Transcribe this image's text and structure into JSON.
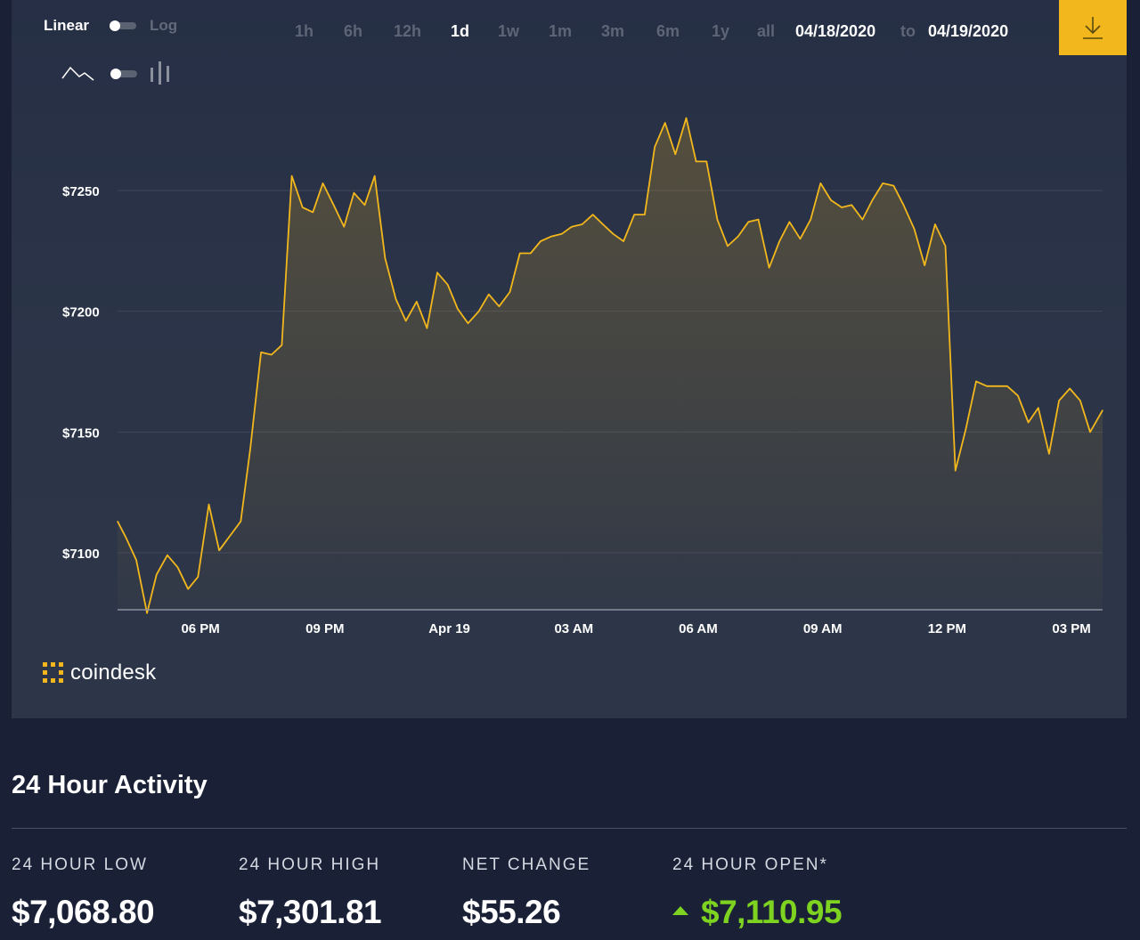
{
  "toolbar": {
    "scale_linear": "Linear",
    "scale_log": "Log",
    "ranges": [
      "1h",
      "6h",
      "12h",
      "1d",
      "1w",
      "1m",
      "3m",
      "6m",
      "1y",
      "all"
    ],
    "active_range": "1d",
    "date_from": "04/18/2020",
    "date_to_label": "to",
    "date_to": "04/19/2020",
    "download_icon": "download-icon",
    "line_icon": "line-chart-icon",
    "bar_icon": "candlestick-icon"
  },
  "brand": {
    "name": "coindesk",
    "icon": "coindesk-logo-icon",
    "color": "#f2b71c"
  },
  "colors": {
    "line": "#f2b71c",
    "accent": "#f2b71c",
    "positive": "#7ed321",
    "background": "#1a2137",
    "panel": "#2b3447"
  },
  "chart_data": {
    "type": "area",
    "x_tick_labels": [
      "06 PM",
      "09 PM",
      "Apr 19",
      "03 AM",
      "06 AM",
      "09 AM",
      "12 PM",
      "03 PM"
    ],
    "y_tick_labels": [
      "$7250",
      "$7200",
      "$7150",
      "$7100"
    ],
    "y_ticks": [
      7250,
      7200,
      7150,
      7100
    ],
    "ylim": [
      7076,
      7280
    ],
    "x_hours": [
      0,
      23.75
    ],
    "grid": true,
    "series": [
      {
        "values": [
          [
            0.0,
            7113
          ],
          [
            0.21,
            7106
          ],
          [
            0.45,
            7097
          ],
          [
            0.71,
            7075
          ],
          [
            0.94,
            7091
          ],
          [
            1.2,
            7099
          ],
          [
            1.45,
            7094
          ],
          [
            1.7,
            7085
          ],
          [
            1.94,
            7090
          ],
          [
            2.2,
            7120
          ],
          [
            2.45,
            7101
          ],
          [
            2.71,
            7107
          ],
          [
            2.97,
            7113
          ],
          [
            3.2,
            7143
          ],
          [
            3.46,
            7183
          ],
          [
            3.71,
            7182
          ],
          [
            3.96,
            7186
          ],
          [
            4.2,
            7256
          ],
          [
            4.46,
            7243
          ],
          [
            4.71,
            7241
          ],
          [
            4.95,
            7253
          ],
          [
            5.21,
            7244
          ],
          [
            5.46,
            7235
          ],
          [
            5.7,
            7249
          ],
          [
            5.96,
            7244
          ],
          [
            6.2,
            7256
          ],
          [
            6.45,
            7222
          ],
          [
            6.71,
            7205
          ],
          [
            6.95,
            7196
          ],
          [
            7.21,
            7204
          ],
          [
            7.46,
            7193
          ],
          [
            7.71,
            7216
          ],
          [
            7.96,
            7211
          ],
          [
            8.2,
            7201
          ],
          [
            8.45,
            7195
          ],
          [
            8.71,
            7200
          ],
          [
            8.95,
            7207
          ],
          [
            9.2,
            7202
          ],
          [
            9.46,
            7208
          ],
          [
            9.7,
            7224
          ],
          [
            9.96,
            7224
          ],
          [
            10.2,
            7229
          ],
          [
            10.46,
            7231
          ],
          [
            10.71,
            7232
          ],
          [
            10.95,
            7235
          ],
          [
            11.2,
            7236
          ],
          [
            11.46,
            7240
          ],
          [
            11.7,
            7236
          ],
          [
            11.95,
            7232
          ],
          [
            12.2,
            7229
          ],
          [
            12.46,
            7240
          ],
          [
            12.71,
            7240
          ],
          [
            12.95,
            7268
          ],
          [
            13.2,
            7278
          ],
          [
            13.45,
            7265
          ],
          [
            13.71,
            7280
          ],
          [
            13.95,
            7262
          ],
          [
            14.2,
            7262
          ],
          [
            14.46,
            7238
          ],
          [
            14.71,
            7227
          ],
          [
            14.96,
            7231
          ],
          [
            15.21,
            7237
          ],
          [
            15.45,
            7238
          ],
          [
            15.71,
            7218
          ],
          [
            15.96,
            7229
          ],
          [
            16.2,
            7237
          ],
          [
            16.46,
            7230
          ],
          [
            16.71,
            7238
          ],
          [
            16.95,
            7253
          ],
          [
            17.2,
            7246
          ],
          [
            17.46,
            7243
          ],
          [
            17.7,
            7244
          ],
          [
            17.96,
            7238
          ],
          [
            18.2,
            7246
          ],
          [
            18.45,
            7253
          ],
          [
            18.71,
            7252
          ],
          [
            18.95,
            7244
          ],
          [
            19.21,
            7234
          ],
          [
            19.46,
            7219
          ],
          [
            19.71,
            7236
          ],
          [
            19.96,
            7227
          ],
          [
            20.2,
            7134
          ],
          [
            20.45,
            7151
          ],
          [
            20.7,
            7171
          ],
          [
            20.96,
            7169
          ],
          [
            21.21,
            7169
          ],
          [
            21.45,
            7169
          ],
          [
            21.71,
            7165
          ],
          [
            21.96,
            7154
          ],
          [
            22.2,
            7160
          ],
          [
            22.46,
            7141
          ],
          [
            22.7,
            7163
          ],
          [
            22.96,
            7168
          ],
          [
            23.21,
            7163
          ],
          [
            23.45,
            7150
          ],
          [
            23.75,
            7159
          ]
        ]
      }
    ]
  },
  "activity": {
    "title": "24 Hour Activity",
    "low_label": "24 HOUR LOW",
    "low_value": "$7,068.80",
    "high_label": "24 HOUR HIGH",
    "high_value": "$7,301.81",
    "change_label": "NET CHANGE",
    "change_value": "$55.26",
    "open_label": "24 HOUR OPEN*",
    "open_value": "$7,110.95",
    "open_icon": "up-triangle-icon"
  }
}
